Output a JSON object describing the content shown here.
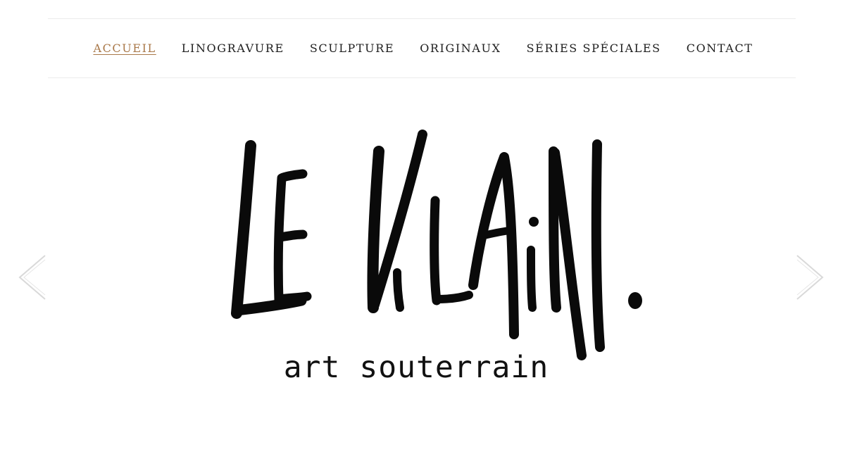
{
  "nav": {
    "items": [
      {
        "label": "ACCUEIL",
        "active": true
      },
      {
        "label": "LINOGRAVURE",
        "active": false
      },
      {
        "label": "SCULPTURE",
        "active": false
      },
      {
        "label": "ORIGINAUX",
        "active": false
      },
      {
        "label": "SÉRIES SPÉCIALES",
        "active": false
      },
      {
        "label": "CONTACT",
        "active": false
      }
    ]
  },
  "hero": {
    "logo_text": "LE VILAIN.",
    "tagline": "art souterrain",
    "prev_icon": "chevron-left-icon",
    "next_icon": "chevron-right-icon"
  },
  "colors": {
    "accent": "#a97849",
    "nav_text": "#1e1e1e",
    "divider": "#ececec",
    "arrow": "#d9d9d9",
    "logo_ink": "#0a0a0a"
  }
}
